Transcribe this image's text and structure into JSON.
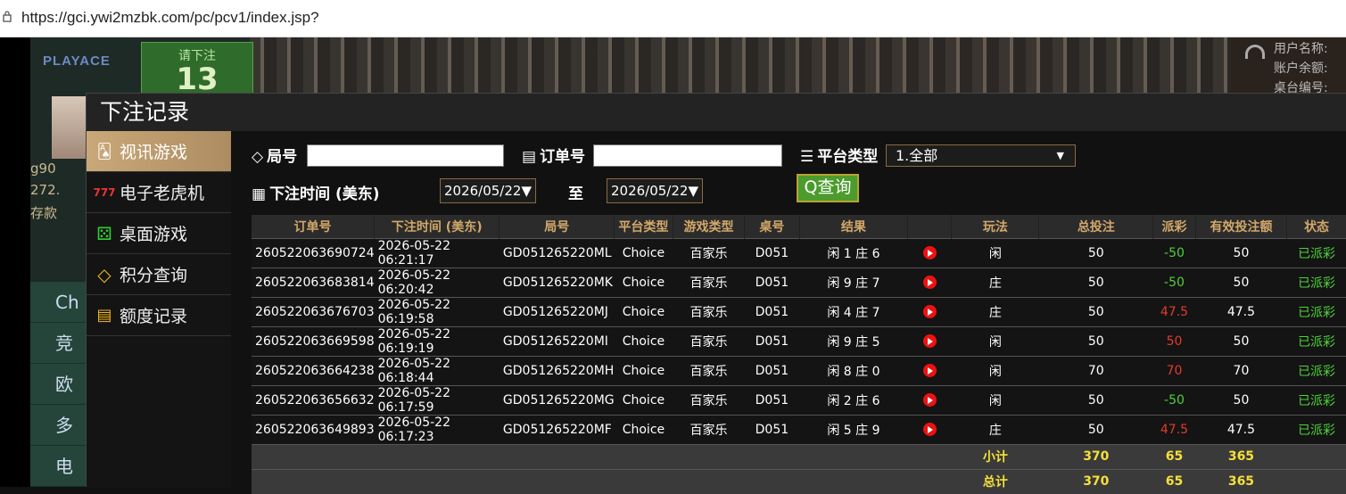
{
  "browser": {
    "url": "https://gci.ywi2mzbk.com/pc/pcv1/index.jsp?"
  },
  "background": {
    "logo": "PLAYACE",
    "bet_prompt": "请下注",
    "bet_count": "13",
    "side_lines": [
      "g90",
      "272.",
      "存款"
    ],
    "menu": [
      "Ch",
      "竞",
      "欧",
      "多",
      "电"
    ],
    "right_lines": [
      "用户名称:",
      "账户余额:",
      "桌台编号:"
    ]
  },
  "modal": {
    "title": "下注记录",
    "sidebar": [
      {
        "label": "视讯游戏",
        "icon": "playing-cards-icon",
        "glyph": "🂡"
      },
      {
        "label": "电子老虎机",
        "icon": "slot-777-icon",
        "glyph": "777"
      },
      {
        "label": "桌面游戏",
        "icon": "dice-icon",
        "glyph": "⚄"
      },
      {
        "label": "积分查询",
        "icon": "diamond-icon",
        "glyph": "◇"
      },
      {
        "label": "额度记录",
        "icon": "document-icon",
        "glyph": "▤"
      }
    ],
    "filters": {
      "round_label": "局号",
      "order_label": "订单号",
      "platform_label": "平台类型",
      "platform_value": "1.全部",
      "time_label": "下注时间 (美东)",
      "date_from": "2026/05/22",
      "date_to": "2026/05/22",
      "to_label": "至",
      "query_label": "查询"
    },
    "table": {
      "headers": [
        "订单号",
        "下注时间 (美东)",
        "局号",
        "平台类型",
        "游戏类型",
        "桌号",
        "结果",
        "",
        "玩法",
        "总投注",
        "派彩",
        "有效投注额",
        "状态"
      ],
      "rows": [
        {
          "order": "260522063690724",
          "time": "2026-05-22 06:21:17",
          "round": "GD051265220ML",
          "platform": "Choice",
          "game": "百家乐",
          "table": "D051",
          "result": "闲 1 庄 6",
          "play": "闲",
          "bet": "50",
          "payout": "-50",
          "payout_color": "green",
          "valid": "50",
          "status": "已派彩"
        },
        {
          "order": "260522063683814",
          "time": "2026-05-22 06:20:42",
          "round": "GD051265220MK",
          "platform": "Choice",
          "game": "百家乐",
          "table": "D051",
          "result": "闲 9 庄 7",
          "play": "庄",
          "bet": "50",
          "payout": "-50",
          "payout_color": "green",
          "valid": "50",
          "status": "已派彩"
        },
        {
          "order": "260522063676703",
          "time": "2026-05-22 06:19:58",
          "round": "GD051265220MJ",
          "platform": "Choice",
          "game": "百家乐",
          "table": "D051",
          "result": "闲 4 庄 7",
          "play": "庄",
          "bet": "50",
          "payout": "47.5",
          "payout_color": "red",
          "valid": "47.5",
          "status": "已派彩"
        },
        {
          "order": "260522063669598",
          "time": "2026-05-22 06:19:19",
          "round": "GD051265220MI",
          "platform": "Choice",
          "game": "百家乐",
          "table": "D051",
          "result": "闲 9 庄 5",
          "play": "闲",
          "bet": "50",
          "payout": "50",
          "payout_color": "red",
          "valid": "50",
          "status": "已派彩"
        },
        {
          "order": "260522063664238",
          "time": "2026-05-22 06:18:44",
          "round": "GD051265220MH",
          "platform": "Choice",
          "game": "百家乐",
          "table": "D051",
          "result": "闲 8 庄 0",
          "play": "闲",
          "bet": "70",
          "payout": "70",
          "payout_color": "red",
          "valid": "70",
          "status": "已派彩"
        },
        {
          "order": "260522063656632",
          "time": "2026-05-22 06:17:59",
          "round": "GD051265220MG",
          "platform": "Choice",
          "game": "百家乐",
          "table": "D051",
          "result": "闲 2 庄 6",
          "play": "闲",
          "bet": "50",
          "payout": "-50",
          "payout_color": "green",
          "valid": "50",
          "status": "已派彩"
        },
        {
          "order": "260522063649893",
          "time": "2026-05-22 06:17:23",
          "round": "GD051265220MF",
          "platform": "Choice",
          "game": "百家乐",
          "table": "D051",
          "result": "闲 5 庄 9",
          "play": "庄",
          "bet": "50",
          "payout": "47.5",
          "payout_color": "red",
          "valid": "47.5",
          "status": "已派彩"
        }
      ],
      "subtotal": {
        "label": "小计",
        "bet": "370",
        "payout": "65",
        "valid": "365"
      },
      "total": {
        "label": "总计",
        "bet": "370",
        "payout": "65",
        "valid": "365"
      }
    }
  }
}
